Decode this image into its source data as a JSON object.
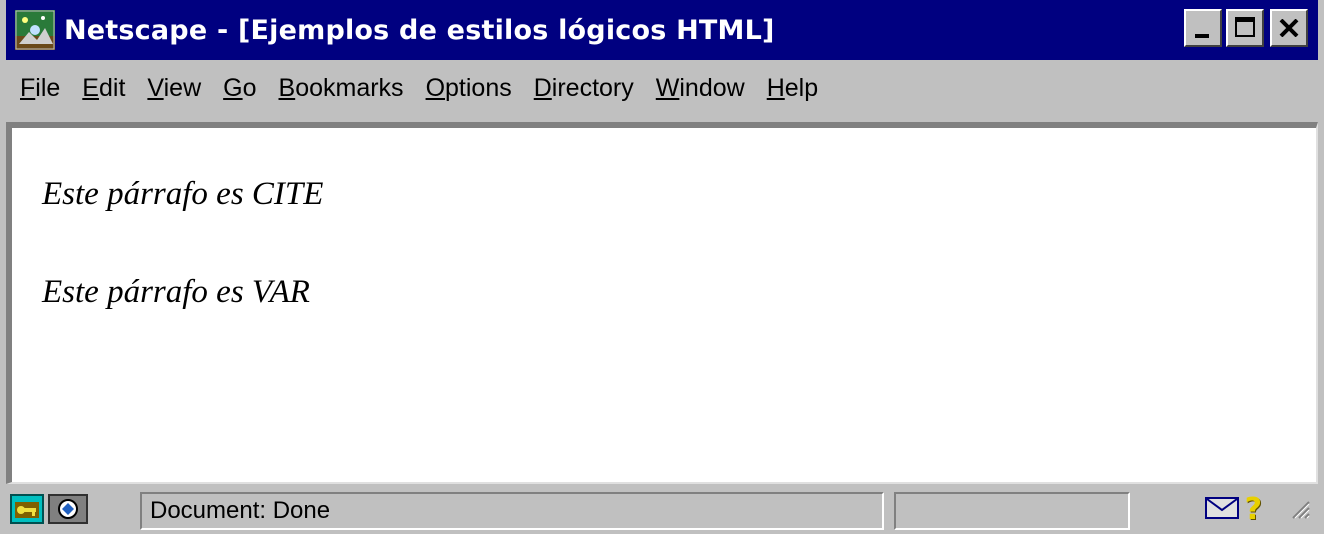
{
  "window": {
    "title": "Netscape - [Ejemplos de estilos lógicos HTML]",
    "title_bar_color": "#000080",
    "app_icon": "netscape-logo-icon",
    "controls": {
      "minimize": "minimize-icon",
      "maximize": "maximize-icon",
      "close": "close-icon"
    }
  },
  "menu": {
    "items": [
      {
        "first": "F",
        "rest": "ile"
      },
      {
        "first": "E",
        "rest": "dit"
      },
      {
        "first": "V",
        "rest": "iew"
      },
      {
        "first": "G",
        "rest": "o"
      },
      {
        "first": "B",
        "rest": "ookmarks"
      },
      {
        "first": "O",
        "rest": "ptions"
      },
      {
        "first": "D",
        "rest": "irectory"
      },
      {
        "first": "W",
        "rest": "indow"
      },
      {
        "first": "H",
        "rest": "elp"
      }
    ]
  },
  "content": {
    "paragraphs": [
      "Este párrafo es CITE",
      "Este párrafo es VAR"
    ]
  },
  "status": {
    "text": "Document: Done",
    "icons": [
      "security-key-icon",
      "connection-icon",
      "mail-icon",
      "help-question-icon"
    ],
    "question_color": "#e8d000"
  }
}
